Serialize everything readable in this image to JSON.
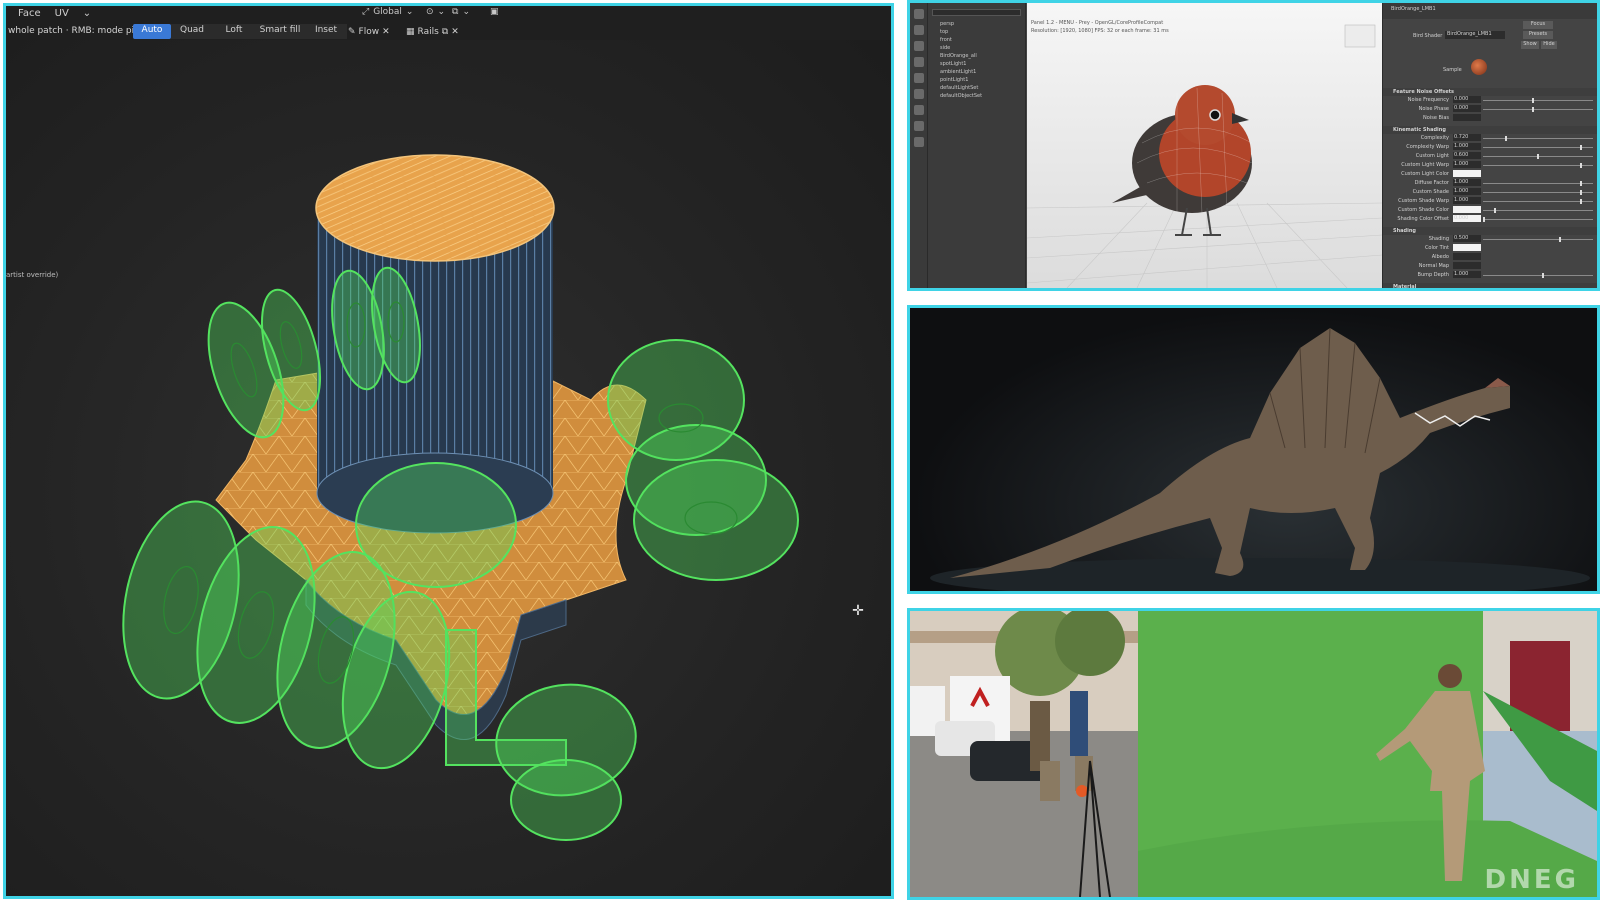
{
  "left_panel": {
    "menu": [
      "Face",
      "UV"
    ],
    "transform_orientation": "Global",
    "hint": "whole patch · RMB: mode pie",
    "mode_tabs": [
      {
        "label": "Auto",
        "active": true
      },
      {
        "label": "Quad",
        "active": false
      },
      {
        "label": "Loft",
        "active": false
      },
      {
        "label": "Smart fill",
        "active": false
      },
      {
        "label": "Inset",
        "active": false
      }
    ],
    "flow_label": "Flow",
    "rails_label": "Rails",
    "side_note": "artist override)"
  },
  "maya_panel": {
    "outliner_items": [
      "persp",
      "top",
      "front",
      "side",
      "BirdOrange_all",
      "spotLight1",
      "ambientLight1",
      "pointLight1",
      "defaultLightSet",
      "defaultObjectSet"
    ],
    "viewport_title": "Panel 1.2 - MENU - Prey - OpenGL/CoreProfileCompat",
    "viewport_info": "Resolution: [1920, 1080]    FPS: 32 or each frame: 31 ms",
    "attr_tab": "BirdOrange_LMB1",
    "attr_shader_label": "Bird Shader",
    "attr_shader_value": "BirdOrange_LMB1",
    "attr_buttons": [
      "Focus",
      "Presets",
      "Show",
      "Hide"
    ],
    "sample_label": "Sample",
    "sections": [
      {
        "title": "Feature Noise Offsets",
        "rows": [
          {
            "label": "Noise Frequency",
            "value": "0.000",
            "knob": 0.45
          },
          {
            "label": "Noise Phase",
            "value": "0.000",
            "knob": 0.45
          },
          {
            "label": "Noise Bias",
            "value": "",
            "knob": null
          }
        ]
      },
      {
        "title": "Kinematic Shading",
        "rows": [
          {
            "label": "Complexity",
            "value": "0.720",
            "knob": 0.2
          },
          {
            "label": "Complexity Warp",
            "value": "1.000",
            "knob": 0.9
          },
          {
            "label": "Custom Light",
            "value": "0.600",
            "knob": 0.5
          },
          {
            "label": "Custom Light Warp",
            "value": "1.000",
            "knob": 0.9
          },
          {
            "label": "Custom Light Color",
            "value": "",
            "knob": null
          },
          {
            "label": "Diffuse Factor",
            "value": "1.000",
            "knob": 0.9
          },
          {
            "label": "Custom Shade",
            "value": "1.000",
            "knob": 0.9
          },
          {
            "label": "Custom Shade Warp",
            "value": "1.000",
            "knob": 0.9
          },
          {
            "label": "Custom Shade Color",
            "value": "",
            "knob": 0.1
          },
          {
            "label": "Shading Color Offset",
            "value": "0.000",
            "knob": 0.0
          }
        ]
      },
      {
        "title": "Shading",
        "rows": [
          {
            "label": "Shading",
            "value": "0.500",
            "knob": 0.7
          },
          {
            "label": "Color Tint",
            "value": "",
            "knob": null
          },
          {
            "label": "Albedo",
            "value": "",
            "knob": null
          },
          {
            "label": "Normal Map",
            "value": "",
            "knob": null
          },
          {
            "label": "Bump Depth",
            "value": "1.000",
            "knob": 0.55
          }
        ]
      },
      {
        "title": "Material",
        "rows": []
      }
    ]
  },
  "set_panel": {
    "watermark": "DNEG"
  },
  "colors": {
    "frame_border": "#3fd3e6",
    "active_tab": "#3a79d6",
    "orange_mesh": "#e9a24a",
    "green_overlay": "#4fdc5b"
  }
}
